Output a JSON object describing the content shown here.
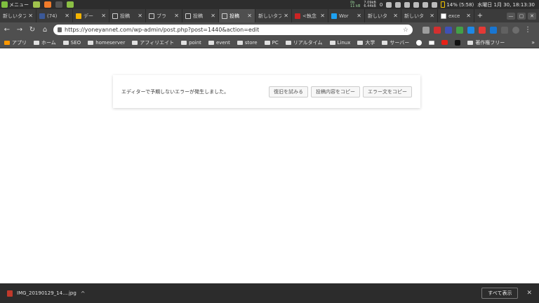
{
  "os_panel": {
    "menu_label": "メニュー",
    "stats_top": "0b",
    "stats_bottom": "11 kB",
    "net_top": "7.09kB",
    "net_bottom": "6.44kB",
    "notif": "0",
    "battery": "14% (5:58)",
    "clock": "水曜日 1月 30, 18:13:30"
  },
  "tabs": [
    {
      "label": "新しいタブ",
      "favicon": "none",
      "active": false
    },
    {
      "label": "(74)",
      "favicon": "facebook-icon",
      "active": false
    },
    {
      "label": "デー",
      "favicon": "drive-icon",
      "active": false
    },
    {
      "label": "投稿",
      "favicon": "page-icon",
      "active": false
    },
    {
      "label": "ブラ",
      "favicon": "page-icon",
      "active": false
    },
    {
      "label": "投稿",
      "favicon": "page-icon",
      "active": false
    },
    {
      "label": "投稿",
      "favicon": "page-icon",
      "active": true
    },
    {
      "label": "新しいタブ",
      "favicon": "none",
      "active": false
    },
    {
      "label": "<執念",
      "favicon": "yahoo-icon",
      "active": false
    },
    {
      "label": "Wor",
      "favicon": "x-icon",
      "active": false
    },
    {
      "label": "新しいタ",
      "favicon": "none",
      "active": false
    },
    {
      "label": "新しいタ",
      "favicon": "none",
      "active": false
    },
    {
      "label": "exce",
      "favicon": "google-icon",
      "active": false
    }
  ],
  "toolbar": {
    "url": "https://yoneyannet.com/wp-admin/post.php?post=1440&action=edit"
  },
  "bookmarks": [
    {
      "label": "アプリ",
      "icon": "apps-icon"
    },
    {
      "label": "ホーム",
      "icon": "folder-icon"
    },
    {
      "label": "SEO",
      "icon": "folder-icon"
    },
    {
      "label": "homeserver",
      "icon": "folder-icon"
    },
    {
      "label": "アフィリエイト",
      "icon": "folder-icon"
    },
    {
      "label": "point",
      "icon": "folder-icon"
    },
    {
      "label": "event",
      "icon": "folder-icon"
    },
    {
      "label": "store",
      "icon": "folder-icon"
    },
    {
      "label": "PC",
      "icon": "folder-icon"
    },
    {
      "label": "リアルタイム",
      "icon": "folder-icon"
    },
    {
      "label": "Linux",
      "icon": "folder-icon"
    },
    {
      "label": "大学",
      "icon": "folder-icon"
    },
    {
      "label": "サーバー",
      "icon": "folder-icon"
    },
    {
      "label": "著作権フリー",
      "icon": "folder-icon"
    }
  ],
  "notice": {
    "message": "エディターで予期しないエラーが発生しました。",
    "buttons": [
      "復旧を試みる",
      "投稿内容をコピー",
      "エラー文をコピー"
    ]
  },
  "download": {
    "filename": "IMG_20190129_14....jpg",
    "show_all": "すべて表示"
  }
}
